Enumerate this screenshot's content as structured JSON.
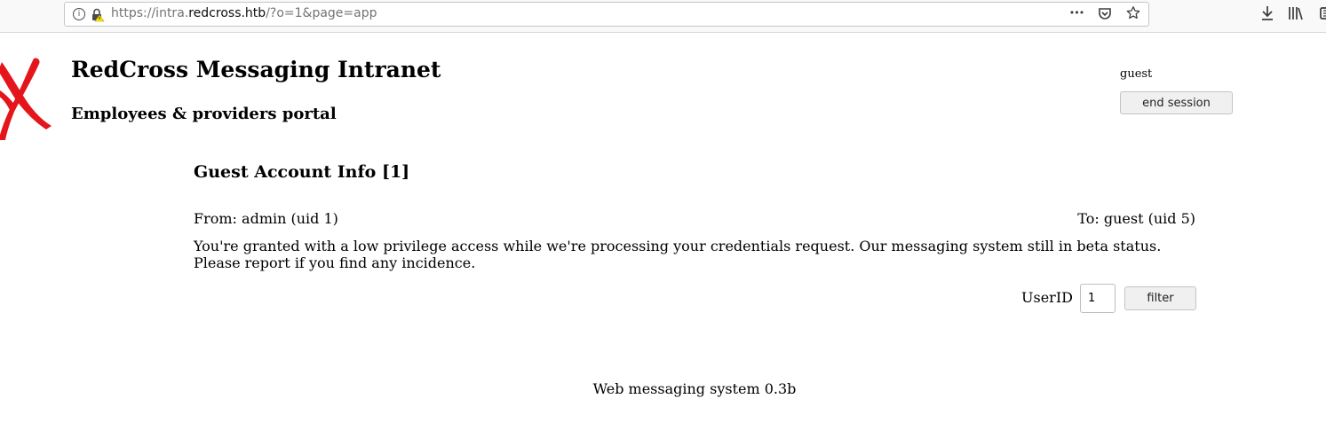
{
  "browser": {
    "url_prefix": "https://intra.",
    "url_host": "redcross.htb",
    "url_suffix": "/?o=1&page=app",
    "info_glyph": "i",
    "page_actions_glyph": "•••",
    "icons": [
      "info-icon",
      "insecure-lock-icon",
      "page-actions-icon",
      "pocket-icon",
      "bookmark-star-icon",
      "downloads-icon",
      "library-icon",
      "sidebar-icon"
    ]
  },
  "header": {
    "logo": "red-cross-x-logo",
    "title": "RedCross Messaging Intranet",
    "subtitle": "Employees & providers portal",
    "accent_color": "#e4161b"
  },
  "session": {
    "user": "guest",
    "end_label": "end session"
  },
  "message": {
    "title": "Guest Account Info [1]",
    "from": "From: admin (uid 1)",
    "to": "To: guest (uid 5)",
    "body": "You're granted with a low privilege access while we're processing your credentials request. Our messaging system still in beta status. Please report if you find any incidence."
  },
  "filter": {
    "label": "UserID",
    "value": "1",
    "button_label": "filter"
  },
  "footer": {
    "text": "Web messaging system 0.3b"
  }
}
